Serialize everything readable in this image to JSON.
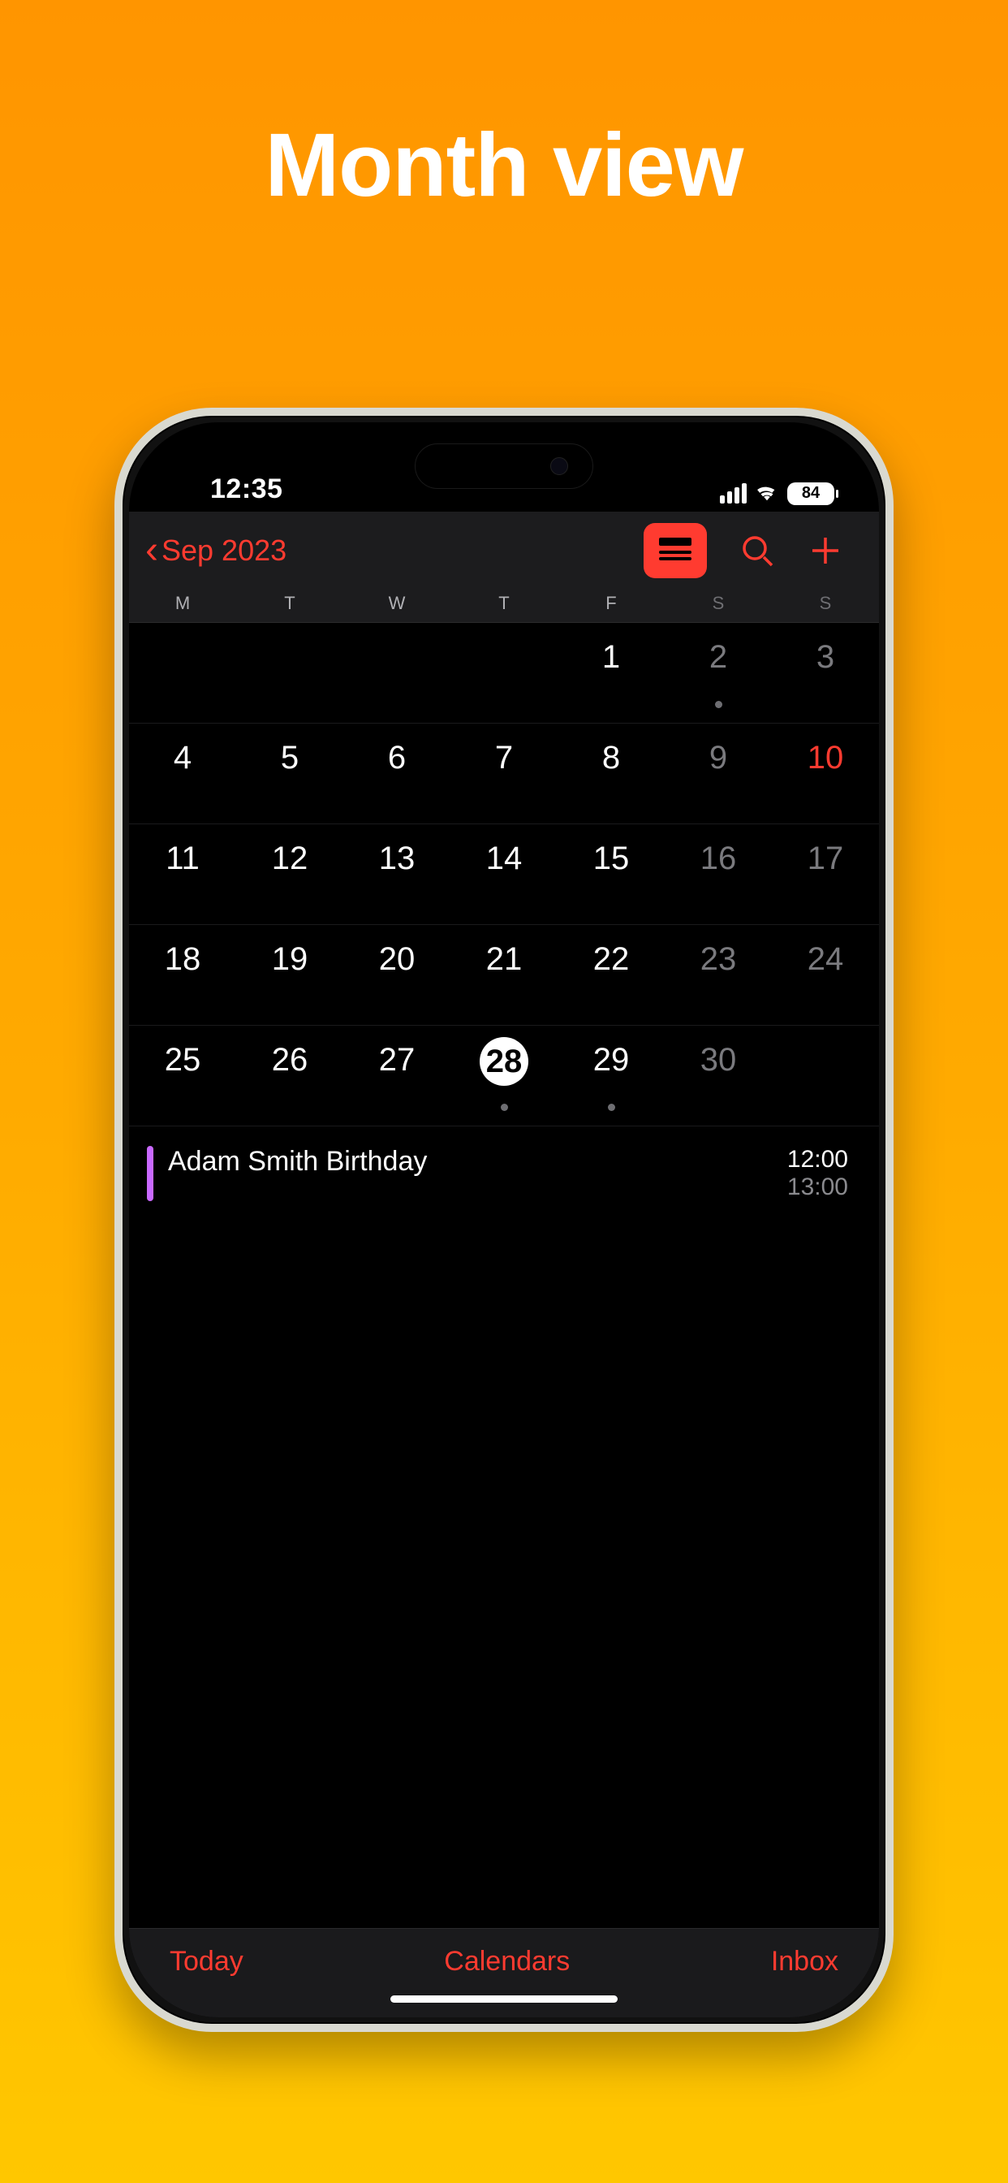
{
  "hero": {
    "title": "Month view"
  },
  "status": {
    "time": "12:35",
    "battery": "84"
  },
  "nav": {
    "month_label": "Sep 2023"
  },
  "weekdays": [
    "M",
    "T",
    "W",
    "T",
    "F",
    "S",
    "S"
  ],
  "grid": [
    {
      "n": "",
      "cls": "empty"
    },
    {
      "n": "",
      "cls": "empty"
    },
    {
      "n": "",
      "cls": "empty"
    },
    {
      "n": "",
      "cls": "empty"
    },
    {
      "n": "1",
      "cls": ""
    },
    {
      "n": "2",
      "cls": "weekend",
      "dot": true
    },
    {
      "n": "3",
      "cls": "weekend"
    },
    {
      "n": "4",
      "cls": ""
    },
    {
      "n": "5",
      "cls": ""
    },
    {
      "n": "6",
      "cls": ""
    },
    {
      "n": "7",
      "cls": ""
    },
    {
      "n": "8",
      "cls": ""
    },
    {
      "n": "9",
      "cls": "weekend"
    },
    {
      "n": "10",
      "cls": "weekend red"
    },
    {
      "n": "11",
      "cls": ""
    },
    {
      "n": "12",
      "cls": ""
    },
    {
      "n": "13",
      "cls": ""
    },
    {
      "n": "14",
      "cls": ""
    },
    {
      "n": "15",
      "cls": ""
    },
    {
      "n": "16",
      "cls": "weekend"
    },
    {
      "n": "17",
      "cls": "weekend"
    },
    {
      "n": "18",
      "cls": ""
    },
    {
      "n": "19",
      "cls": ""
    },
    {
      "n": "20",
      "cls": ""
    },
    {
      "n": "21",
      "cls": ""
    },
    {
      "n": "22",
      "cls": ""
    },
    {
      "n": "23",
      "cls": "weekend"
    },
    {
      "n": "24",
      "cls": "weekend"
    },
    {
      "n": "25",
      "cls": ""
    },
    {
      "n": "26",
      "cls": ""
    },
    {
      "n": "27",
      "cls": ""
    },
    {
      "n": "28",
      "cls": "selected",
      "dot": true
    },
    {
      "n": "29",
      "cls": "",
      "dot": true
    },
    {
      "n": "30",
      "cls": "weekend"
    },
    {
      "n": "",
      "cls": "empty weekend"
    }
  ],
  "events": [
    {
      "title": "Adam Smith Birthday",
      "start": "12:00",
      "end": "13:00",
      "color": "#c969ff"
    }
  ],
  "toolbar": {
    "today": "Today",
    "calendars": "Calendars",
    "inbox": "Inbox"
  }
}
